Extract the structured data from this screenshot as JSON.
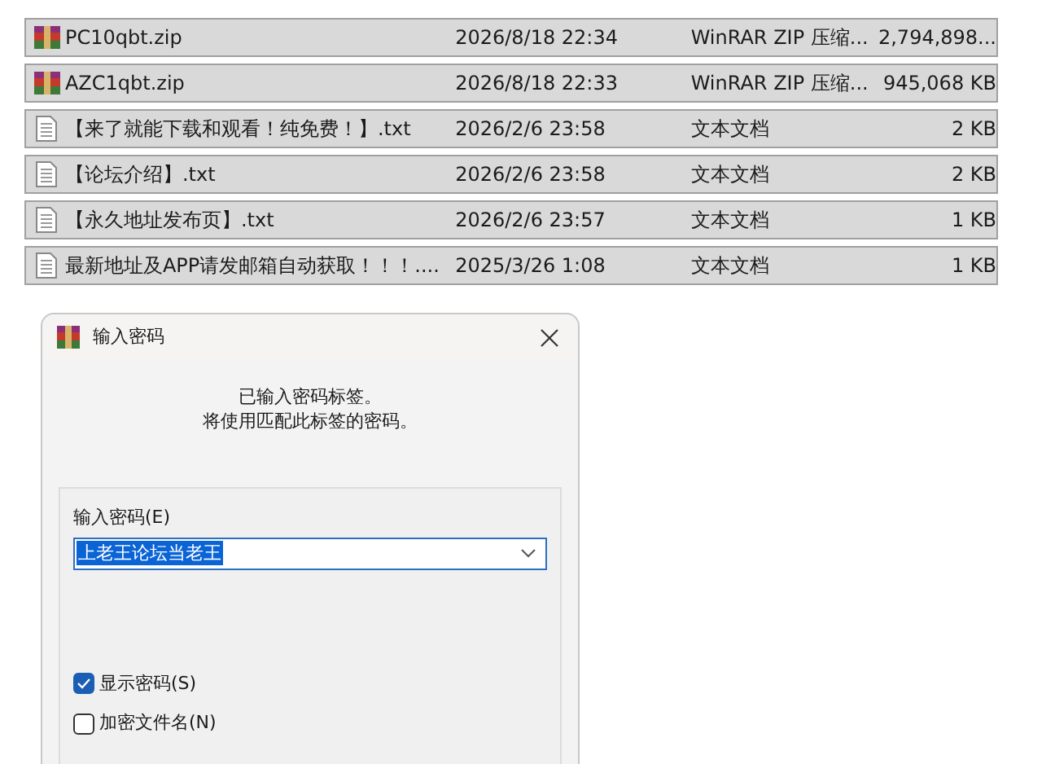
{
  "files": [
    {
      "kind": "archive",
      "name": "PC10qbt.zip",
      "date": "2026/8/18 22:34",
      "type": "WinRAR ZIP 压缩...",
      "size": "2,794,898...",
      "selected": true
    },
    {
      "kind": "archive",
      "name": "AZC1qbt.zip",
      "date": "2026/8/18 22:33",
      "type": "WinRAR ZIP 压缩...",
      "size": "945,068 KB",
      "selected": true
    },
    {
      "kind": "text",
      "name": "【来了就能下载和观看！纯免费！】.txt",
      "date": "2026/2/6 23:58",
      "type": "文本文档",
      "size": "2 KB",
      "selected": true
    },
    {
      "kind": "text",
      "name": "【论坛介绍】.txt",
      "date": "2026/2/6 23:58",
      "type": "文本文档",
      "size": "2 KB",
      "selected": true
    },
    {
      "kind": "text",
      "name": "【永久地址发布页】.txt",
      "date": "2026/2/6 23:57",
      "type": "文本文档",
      "size": "1 KB",
      "selected": true
    },
    {
      "kind": "text",
      "name": "最新地址及APP请发邮箱自动获取！！！....",
      "date": "2025/3/26 1:08",
      "type": "文本文档",
      "size": "1 KB",
      "selected": true
    }
  ],
  "dialog": {
    "title": "输入密码",
    "message": [
      "已输入密码标签。",
      "将使用匹配此标签的密码。"
    ],
    "password_label": "输入密码(E)",
    "password_value": "上老王论坛当老王",
    "options": [
      {
        "label": "显示密码(S)",
        "checked": true
      },
      {
        "label": "加密文件名(N)",
        "checked": false
      }
    ]
  }
}
